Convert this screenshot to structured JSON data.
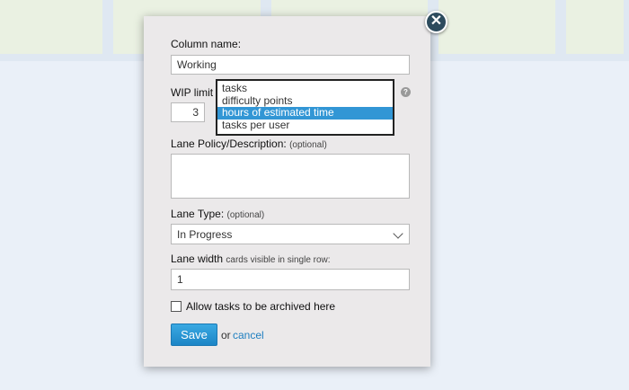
{
  "dialog": {
    "column_name_label": "Column name:",
    "column_name_value": "Working",
    "wip_limit_label": "WIP limit",
    "wip_limit_value": "3",
    "wip_unit_options": [
      "tasks",
      "difficulty points",
      "hours of estimated time",
      "tasks per user"
    ],
    "wip_unit_selected": "hours of estimated time",
    "help_icon": "question-icon",
    "lane_policy_label": "Lane Policy/Description:",
    "lane_policy_optional": "(optional)",
    "lane_policy_value": "",
    "lane_type_label": "Lane Type:",
    "lane_type_optional": "(optional)",
    "lane_type_value": "In Progress",
    "lane_width_label": "Lane width",
    "lane_width_hint": "cards visible in single row:",
    "lane_width_value": "1",
    "archive_label": "Allow tasks to be archived here",
    "archive_checked": false,
    "save_label": "Save",
    "or_text": "or",
    "cancel_label": "cancel",
    "close_icon": "close-icon"
  },
  "colors": {
    "accent": "#1c85c6",
    "dialog_bg": "#ebe9ea",
    "selected_option": "#3296d5",
    "close_button": "#2d4b5d"
  }
}
